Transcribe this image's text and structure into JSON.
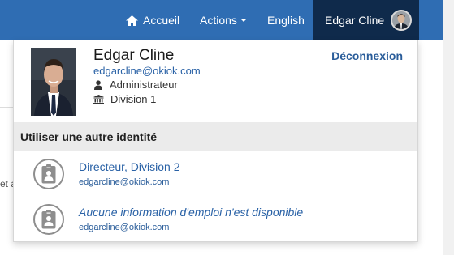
{
  "navbar": {
    "home_label": "Accueil",
    "actions_label": "Actions",
    "language_label": "English",
    "user_label": "Edgar Cline",
    "bg_color": "#2f6db3",
    "user_bg_color": "#0f2a4b"
  },
  "background": {
    "partial_text": "et a"
  },
  "profile": {
    "name": "Edgar Cline",
    "email": "edgarcline@okiok.com",
    "role": "Administrateur",
    "division": "Division 1",
    "logout_label": "Déconnexion"
  },
  "switch_identity": {
    "heading": "Utiliser une autre identité",
    "items": [
      {
        "title": "Directeur, Division 2",
        "email": "edgarcline@okiok.com",
        "icon": "id-badge-icon"
      },
      {
        "title": "Aucune information d'emploi n'est disponible",
        "email": "edgarcline@okiok.com",
        "icon": "id-badge-icon"
      }
    ]
  }
}
